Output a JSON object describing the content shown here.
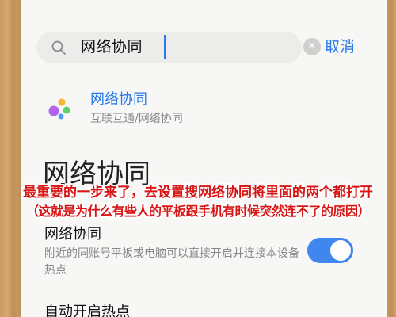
{
  "search": {
    "query": "网络协同",
    "cancel_label": "取消",
    "clear_symbol": "✕"
  },
  "result": {
    "title": "网络协同",
    "path": "互联互通/网络协同",
    "icon": "multi-color-dots-icon",
    "colors": [
      "#f6b531",
      "#5fcf68",
      "#b262ef",
      "#4f9bf4"
    ]
  },
  "page": {
    "title": "网络协同"
  },
  "settings": [
    {
      "label": "网络协同",
      "description": "附近的同账号平板或电脑可以直接开启并连接本设备热点",
      "enabled": true
    },
    {
      "label": "自动开启热点"
    }
  ],
  "overlay": {
    "line1": "最重要的一步来了，去设置搜网络协同将里面的两个都打开",
    "line2": "（这就是为什么有些人的平板跟手机有时候突然连不了的原因）",
    "color": "#d81414"
  },
  "theme": {
    "accent": "#2a7ae9",
    "toggle_on": "#3f87ef"
  }
}
